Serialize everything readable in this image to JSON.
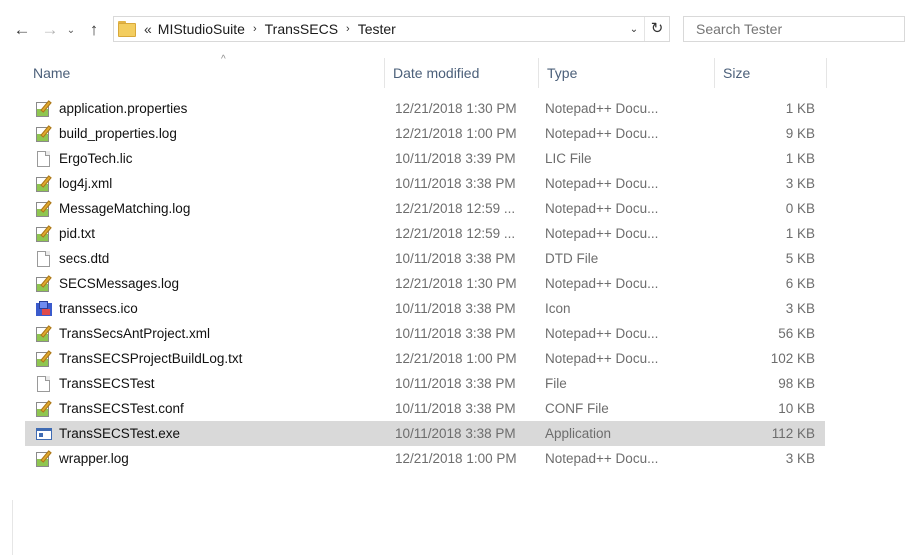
{
  "nav": {
    "back": "←",
    "forward": "→",
    "recent": "⌄",
    "up": "↑"
  },
  "address": {
    "overflow": "«",
    "crumbs": [
      "MIStudioSuite",
      "TransSECS",
      "Tester"
    ],
    "separator": "›",
    "dropdown": "⌄",
    "refresh": "↻"
  },
  "search": {
    "placeholder": "Search Tester"
  },
  "columns": {
    "name": "Name",
    "date": "Date modified",
    "type": "Type",
    "size": "Size",
    "sort_indicator": "^"
  },
  "files": [
    {
      "name": "application.properties",
      "date": "12/21/2018 1:30 PM",
      "type": "Notepad++ Docu...",
      "size": "1 KB",
      "icon": "npp"
    },
    {
      "name": "build_properties.log",
      "date": "12/21/2018 1:00 PM",
      "type": "Notepad++ Docu...",
      "size": "9 KB",
      "icon": "npp"
    },
    {
      "name": "ErgoTech.lic",
      "date": "10/11/2018 3:39 PM",
      "type": "LIC File",
      "size": "1 KB",
      "icon": "blank"
    },
    {
      "name": "log4j.xml",
      "date": "10/11/2018 3:38 PM",
      "type": "Notepad++ Docu...",
      "size": "3 KB",
      "icon": "npp"
    },
    {
      "name": "MessageMatching.log",
      "date": "12/21/2018 12:59 ...",
      "type": "Notepad++ Docu...",
      "size": "0 KB",
      "icon": "npp"
    },
    {
      "name": "pid.txt",
      "date": "12/21/2018 12:59 ...",
      "type": "Notepad++ Docu...",
      "size": "1 KB",
      "icon": "npp"
    },
    {
      "name": "secs.dtd",
      "date": "10/11/2018 3:38 PM",
      "type": "DTD File",
      "size": "5 KB",
      "icon": "blank"
    },
    {
      "name": "SECSMessages.log",
      "date": "12/21/2018 1:30 PM",
      "type": "Notepad++ Docu...",
      "size": "6 KB",
      "icon": "npp"
    },
    {
      "name": "transsecs.ico",
      "date": "10/11/2018 3:38 PM",
      "type": "Icon",
      "size": "3 KB",
      "icon": "ico"
    },
    {
      "name": "TransSecsAntProject.xml",
      "date": "10/11/2018 3:38 PM",
      "type": "Notepad++ Docu...",
      "size": "56 KB",
      "icon": "npp"
    },
    {
      "name": "TransSECSProjectBuildLog.txt",
      "date": "12/21/2018 1:00 PM",
      "type": "Notepad++ Docu...",
      "size": "102 KB",
      "icon": "npp"
    },
    {
      "name": "TransSECSTest",
      "date": "10/11/2018 3:38 PM",
      "type": "File",
      "size": "98 KB",
      "icon": "blank"
    },
    {
      "name": "TransSECSTest.conf",
      "date": "10/11/2018 3:38 PM",
      "type": "CONF File",
      "size": "10 KB",
      "icon": "npp"
    },
    {
      "name": "TransSECSTest.exe",
      "date": "10/11/2018 3:38 PM",
      "type": "Application",
      "size": "112 KB",
      "icon": "exe",
      "selected": true
    },
    {
      "name": "wrapper.log",
      "date": "12/21/2018 1:00 PM",
      "type": "Notepad++ Docu...",
      "size": "3 KB",
      "icon": "npp"
    }
  ],
  "colors": {
    "selected_row": "#d9d9d9",
    "header_text": "#4c607a",
    "folder": "#f3cd5f"
  }
}
